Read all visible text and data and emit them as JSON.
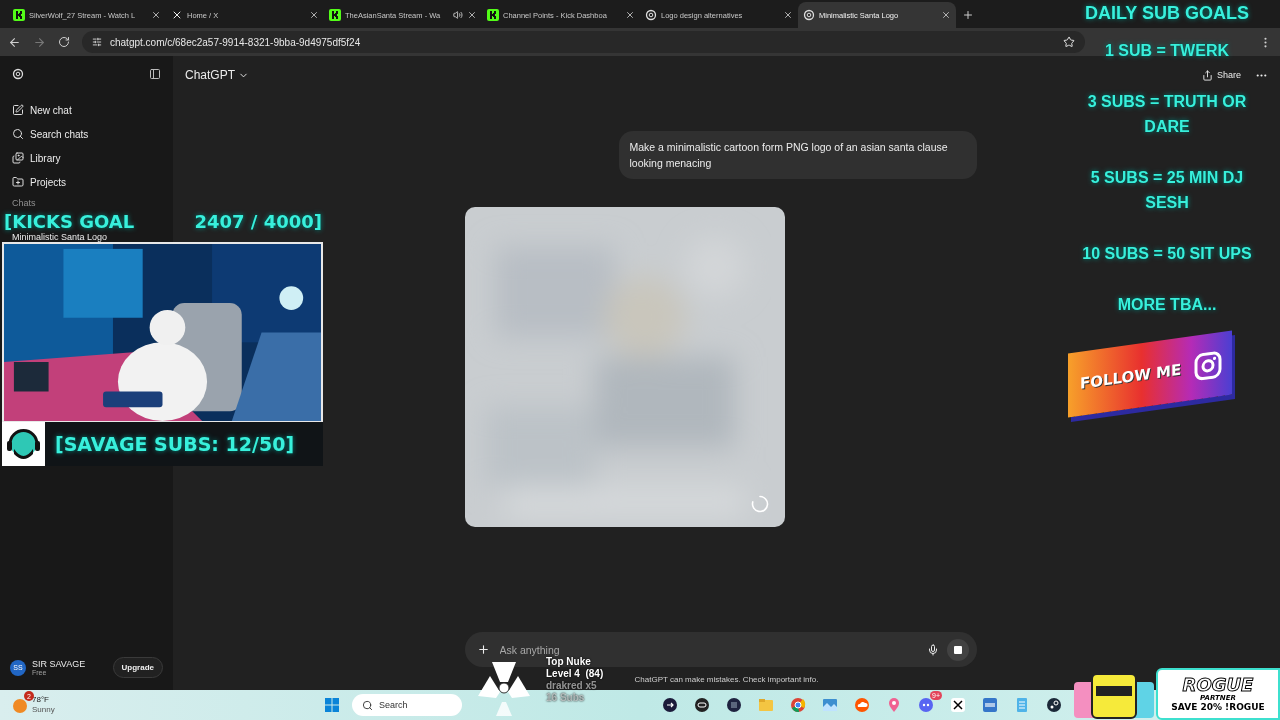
{
  "browser": {
    "tabs": [
      {
        "title": "SilverWolf_27 Stream - Watch L",
        "audio": false,
        "selected": false
      },
      {
        "title": "Home / X",
        "audio": false,
        "selected": false
      },
      {
        "title": "TheAsianSanta Stream - Wa",
        "audio": true,
        "selected": false
      },
      {
        "title": "Channel Points - Kick Dashboa",
        "audio": false,
        "selected": false
      },
      {
        "title": "Logo design alternatives",
        "audio": false,
        "selected": false
      },
      {
        "title": "Minimalistic Santa Logo",
        "audio": false,
        "selected": true
      }
    ],
    "address": "chatgpt.com/c/68ec2a57-9914-8321-9bba-9d4975df5f24"
  },
  "sidebar": {
    "items": [
      {
        "label": "New chat"
      },
      {
        "label": "Search chats"
      },
      {
        "label": "Library"
      },
      {
        "label": "Projects"
      }
    ],
    "section": "Chats",
    "chats": [
      {
        "title": "Minimalistic Santa Logo"
      }
    ],
    "user": {
      "initials": "SS",
      "name": "SIR SAVAGE",
      "plan": "Free",
      "upgrade": "Upgrade"
    }
  },
  "chat": {
    "model": "ChatGPT",
    "share": "Share",
    "message": "Make a minimalistic cartoon form PNG logo of an asian santa clause looking menacing",
    "image": {
      "kind": "picture",
      "loading": true
    },
    "composer": {
      "placeholder": "Ask anything"
    },
    "disclaimer": "ChatGPT can make mistakes. Check important info."
  },
  "taskbar": {
    "weather": {
      "badge": "2",
      "temp": "78°F",
      "condition": "Sunny"
    },
    "search": {
      "placeholder": "Search"
    },
    "chat_badge": "9+"
  },
  "overlay": {
    "kicks_goal": {
      "label": "[KICKS GOAL",
      "count": "2407 / 4000]"
    },
    "webcam": {
      "kind": "picture"
    },
    "subs": "[SAVAGE SUBS: 12/50]",
    "goals_title": "DAILY SUB GOALS",
    "goals": [
      "1 SUB = TWERK",
      "3 SUBS = TRUTH OR DARE",
      "5 SUBS = 25 MIN DJ SESH",
      "10 SUBS = 50 SIT UPS",
      "MORE TBA..."
    ],
    "follow": "FOLLOW ME",
    "alert": {
      "title": "Top Nuke",
      "level": "Level 4  (84)",
      "user": "drakred x5",
      "subs": "16 Subs"
    },
    "ad": {
      "brand": "ROGUE",
      "tag": "PARTNER",
      "offer": "SAVE 20% !ROGUE"
    }
  }
}
